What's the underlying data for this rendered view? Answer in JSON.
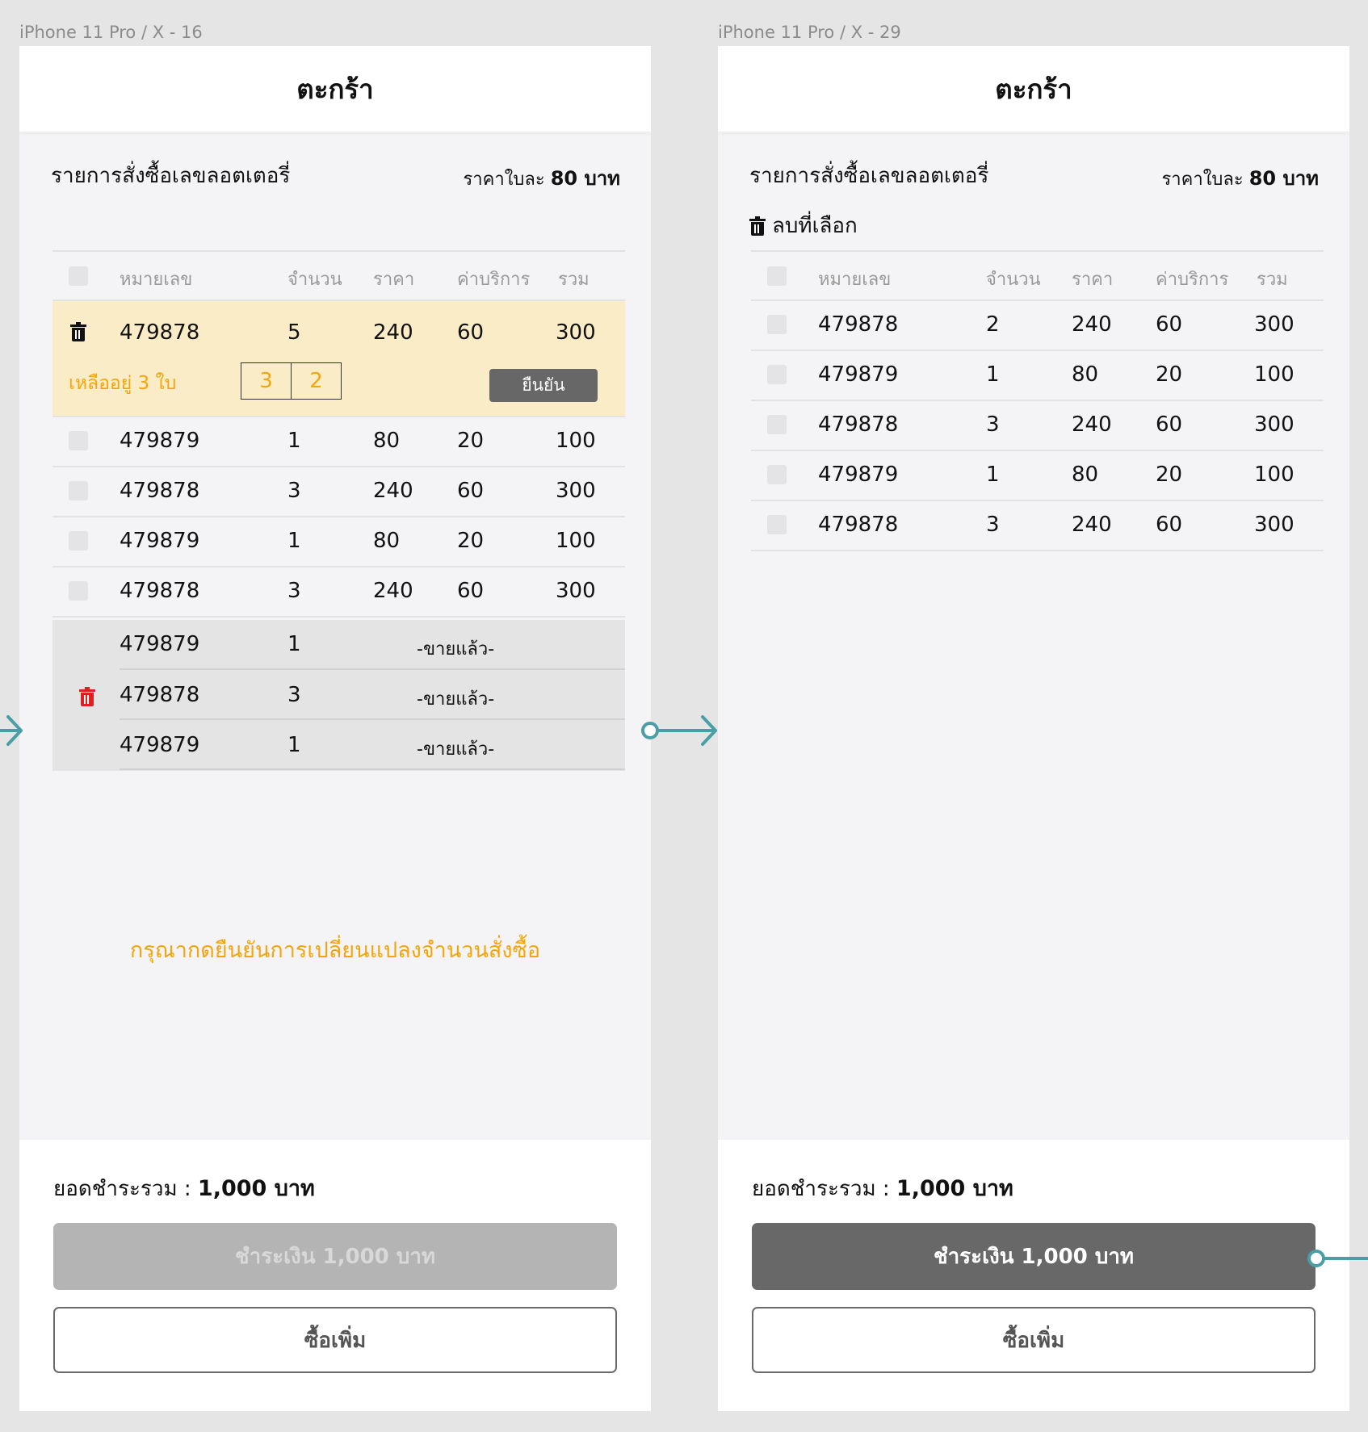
{
  "screens": [
    {
      "frame_label": "iPhone 11 Pro / X - 16",
      "title": "ตะกร้า",
      "section_title": "รายการสั่งซื้อเลขลอตเตอรี่",
      "price_note_prefix": "ราคาใบละ",
      "price_note_value": "80 บาท",
      "columns": [
        "หมายเลข",
        "จำนวน",
        "ราคา",
        "ค่าบริการ",
        "รวม"
      ],
      "edit_row": {
        "number": "479878",
        "qty": "5",
        "price": "240",
        "fee": "60",
        "total": "300",
        "remaining_text": "เหลืออยู่ 3 ใบ",
        "qty_options": [
          "3",
          "2"
        ],
        "confirm_label": "ยืนยัน"
      },
      "rows": [
        {
          "number": "479879",
          "qty": "1",
          "price": "80",
          "fee": "20",
          "total": "100"
        },
        {
          "number": "479878",
          "qty": "3",
          "price": "240",
          "fee": "60",
          "total": "300"
        },
        {
          "number": "479879",
          "qty": "1",
          "price": "80",
          "fee": "20",
          "total": "100"
        },
        {
          "number": "479878",
          "qty": "3",
          "price": "240",
          "fee": "60",
          "total": "300"
        }
      ],
      "sold_rows": [
        {
          "number": "479879",
          "qty": "1",
          "status": "-ขายแล้ว-"
        },
        {
          "number": "479878",
          "qty": "3",
          "status": "-ขายแล้ว-"
        },
        {
          "number": "479879",
          "qty": "1",
          "status": "-ขายแล้ว-"
        }
      ],
      "notice": "กรุณากดยืนยันการเปลี่ยนแปลงจำนวนสั่งซื้อ",
      "total_label": "ยอดชำระรวม :",
      "total_value": "1,000 บาท",
      "pay_label": "ชำระเงิน 1,000 บาท",
      "more_label": "ซื้อเพิ่ม"
    },
    {
      "frame_label": "iPhone 11 Pro / X - 29",
      "title": "ตะกร้า",
      "section_title": "รายการสั่งซื้อเลขลอตเตอรี่",
      "price_note_prefix": "ราคาใบละ",
      "price_note_value": "80 บาท",
      "delete_selected": "ลบที่เลือก",
      "columns": [
        "หมายเลข",
        "จำนวน",
        "ราคา",
        "ค่าบริการ",
        "รวม"
      ],
      "rows": [
        {
          "number": "479878",
          "qty": "2",
          "price": "240",
          "fee": "60",
          "total": "300"
        },
        {
          "number": "479879",
          "qty": "1",
          "price": "80",
          "fee": "20",
          "total": "100"
        },
        {
          "number": "479878",
          "qty": "3",
          "price": "240",
          "fee": "60",
          "total": "300"
        },
        {
          "number": "479879",
          "qty": "1",
          "price": "80",
          "fee": "20",
          "total": "100"
        },
        {
          "number": "479878",
          "qty": "3",
          "price": "240",
          "fee": "60",
          "total": "300"
        }
      ],
      "total_label": "ยอดชำระรวม :",
      "total_value": "1,000 บาท",
      "pay_label": "ชำระเงิน 1,000 บาท",
      "more_label": "ซื้อเพิ่ม"
    }
  ],
  "colors": {
    "accent_orange": "#f3a60c",
    "edit_row_bg": "#faecc6",
    "trash_red": "#e02020",
    "connector_teal": "#4b9ea5"
  }
}
